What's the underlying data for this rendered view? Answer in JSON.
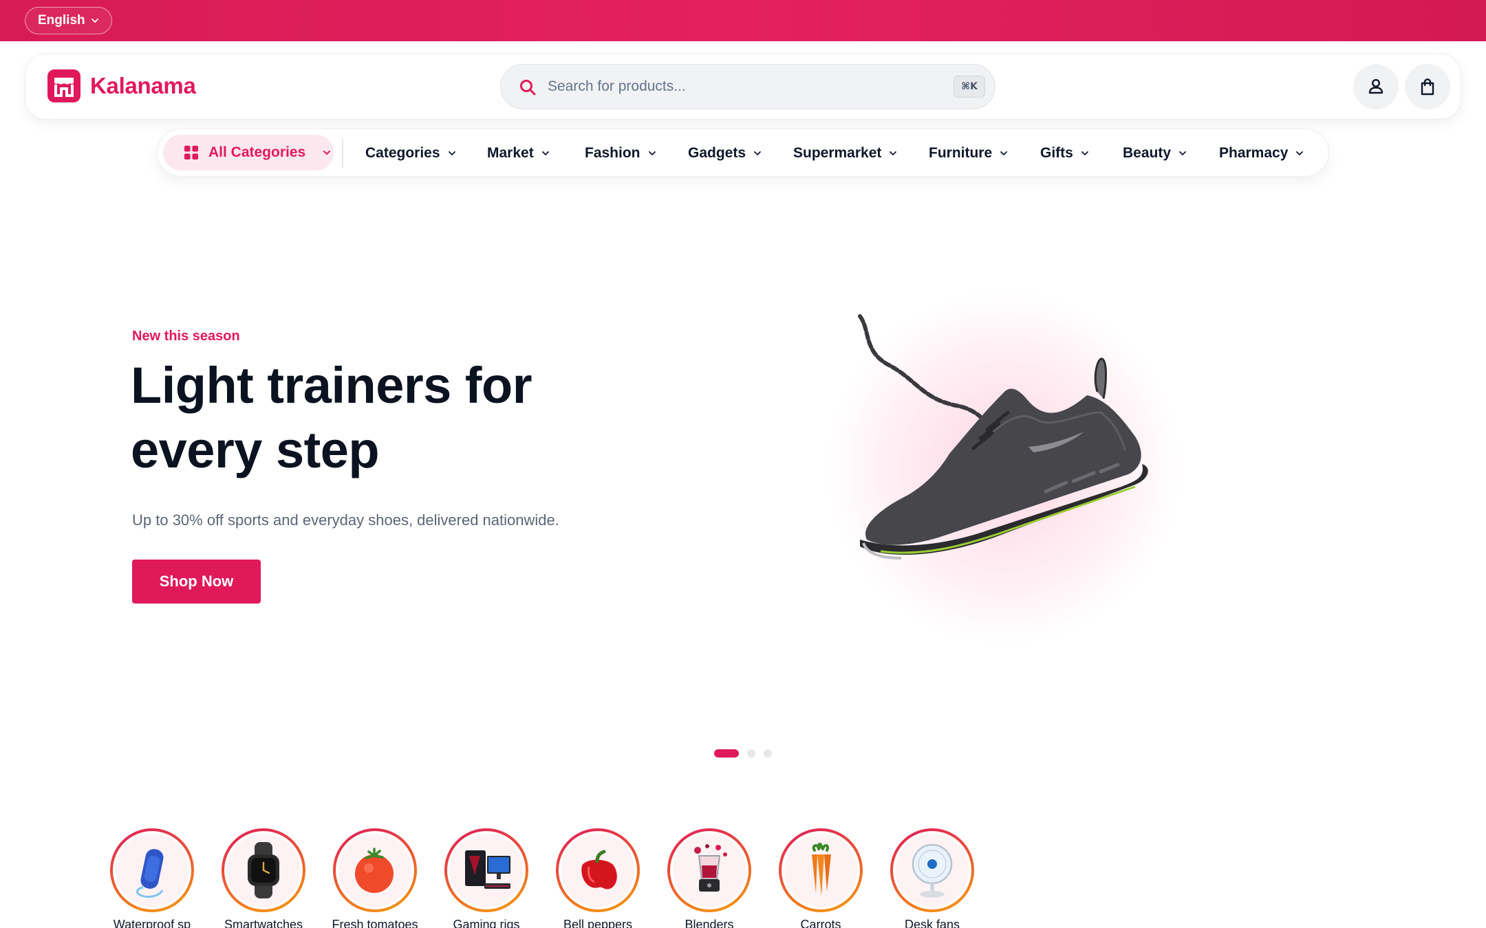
{
  "topbar": {
    "language": "English"
  },
  "brand": {
    "name": "Kalanama",
    "color": "#e0195a"
  },
  "search": {
    "placeholder": "Search for products...",
    "value": "",
    "shortcut": "⌘K"
  },
  "header_icons": [
    "account-icon",
    "shopping-bag-icon"
  ],
  "nav": {
    "all_categories": "All Categories",
    "items": [
      "Categories",
      "Market",
      "Fashion",
      "Gadgets",
      "Supermarket",
      "Furniture",
      "Gifts",
      "Beauty",
      "Pharmacy"
    ]
  },
  "hero": {
    "eyebrow": "New this season",
    "headline": "Light trainers for every step",
    "subcopy": "Up to 30% off sports and everyday shoes, delivered nationwide.",
    "cta": "Shop Now",
    "slides_total": 3,
    "active_slide": 1
  },
  "categories": [
    {
      "label": "Waterproof sp",
      "icon": "speaker-icon"
    },
    {
      "label": "Smartwatches",
      "icon": "smartwatch-icon"
    },
    {
      "label": "Fresh tomatoes",
      "icon": "tomato-icon"
    },
    {
      "label": "Gaming rigs",
      "icon": "gaming-pc-icon"
    },
    {
      "label": "Bell peppers",
      "icon": "bell-pepper-icon"
    },
    {
      "label": "Blenders",
      "icon": "blender-icon"
    },
    {
      "label": "Carrots",
      "icon": "carrot-icon"
    },
    {
      "label": "Desk fans",
      "icon": "desk-fan-icon"
    }
  ]
}
